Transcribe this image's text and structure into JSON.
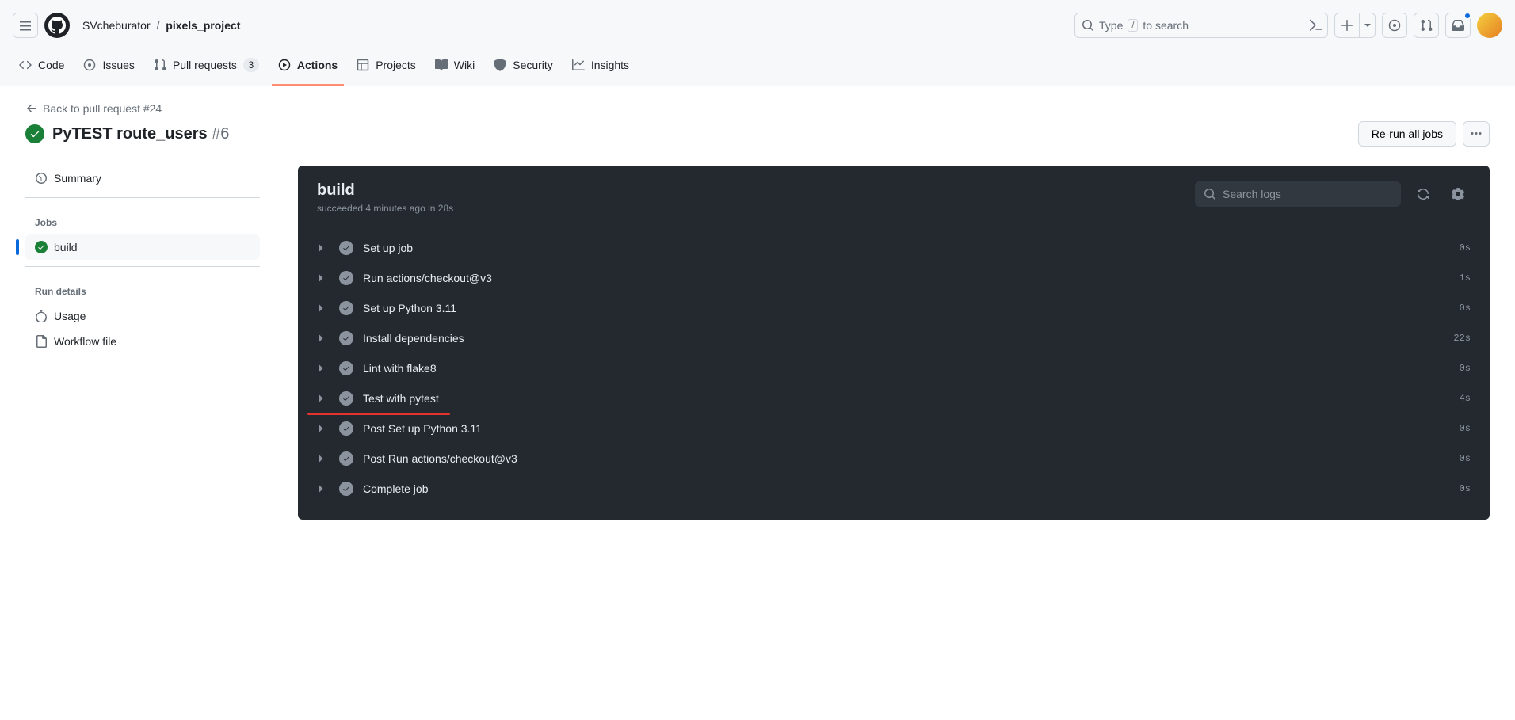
{
  "header": {
    "owner": "SVcheburator",
    "repo": "pixels_project",
    "search_placeholder_pre": "Type ",
    "search_key": "/",
    "search_placeholder_post": " to search"
  },
  "nav": {
    "code": "Code",
    "issues": "Issues",
    "pulls": "Pull requests",
    "pulls_count": "3",
    "actions": "Actions",
    "projects": "Projects",
    "wiki": "Wiki",
    "security": "Security",
    "insights": "Insights"
  },
  "page": {
    "back": "Back to pull request #24",
    "title": "PyTEST route_users",
    "run_num": "#6",
    "rerun": "Re-run all jobs"
  },
  "sidebar": {
    "summary": "Summary",
    "jobs_heading": "Jobs",
    "job": "build",
    "details_heading": "Run details",
    "usage": "Usage",
    "workflow": "Workflow file"
  },
  "panel": {
    "title": "build",
    "meta": "succeeded 4 minutes ago in 28s",
    "search_placeholder": "Search logs",
    "steps": [
      {
        "name": "Set up job",
        "dur": "0s"
      },
      {
        "name": "Run actions/checkout@v3",
        "dur": "1s"
      },
      {
        "name": "Set up Python 3.11",
        "dur": "0s"
      },
      {
        "name": "Install dependencies",
        "dur": "22s"
      },
      {
        "name": "Lint with flake8",
        "dur": "0s"
      },
      {
        "name": "Test with pytest",
        "dur": "4s"
      },
      {
        "name": "Post Set up Python 3.11",
        "dur": "0s"
      },
      {
        "name": "Post Run actions/checkout@v3",
        "dur": "0s"
      },
      {
        "name": "Complete job",
        "dur": "0s"
      }
    ]
  }
}
